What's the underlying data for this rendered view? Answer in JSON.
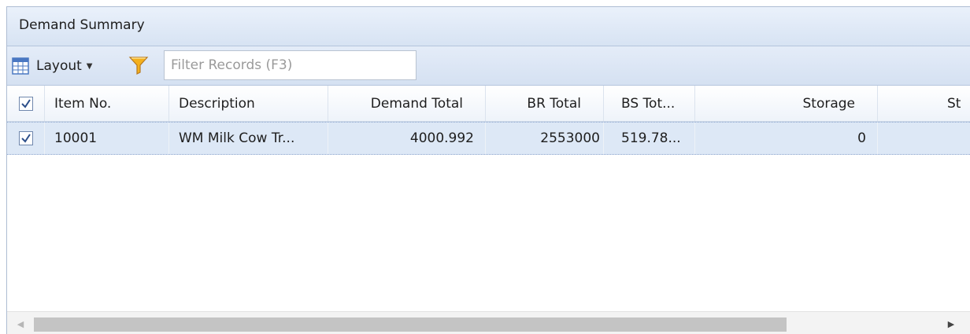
{
  "panel": {
    "title": "Demand Summary"
  },
  "toolbar": {
    "layout_label": "Layout",
    "filter_placeholder": "Filter Records (F3)",
    "filter_value": ""
  },
  "grid": {
    "header_checked": true,
    "columns": [
      "Item No.",
      "Description",
      "Demand Total",
      "BR Total",
      "BS Tot...",
      "Storage",
      "St"
    ],
    "rows": [
      {
        "checked": true,
        "item_no": "10001",
        "description": "WM Milk Cow Tr...",
        "demand_total": "4000.992",
        "br_total": "2553000",
        "bs_total": "519.78...",
        "storage": "0"
      }
    ]
  },
  "colors": {
    "header_bg": "#d7e3f3",
    "selected_row": "#dde8f6",
    "scroll_thumb": "#c4c4c4"
  }
}
